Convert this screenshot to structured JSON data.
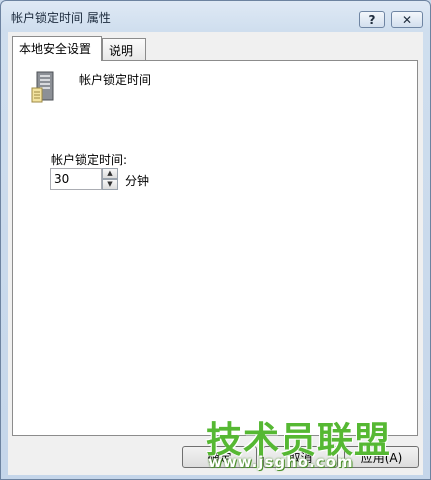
{
  "window": {
    "title": "帐户锁定时间 属性",
    "help_label": "?",
    "close_label": "✕"
  },
  "tabs": [
    {
      "label": "本地安全设置",
      "active": true
    },
    {
      "label": "说明",
      "active": false
    }
  ],
  "policy": {
    "icon": "server-icon",
    "title": "帐户锁定时间"
  },
  "field": {
    "label": "帐户锁定时间:",
    "value": "30",
    "unit": "分钟"
  },
  "buttons": {
    "ok": "确定",
    "cancel": "取消",
    "apply": "应用(A)"
  },
  "watermark": {
    "text": "技术员联盟",
    "url": "www.jsgho.com"
  }
}
